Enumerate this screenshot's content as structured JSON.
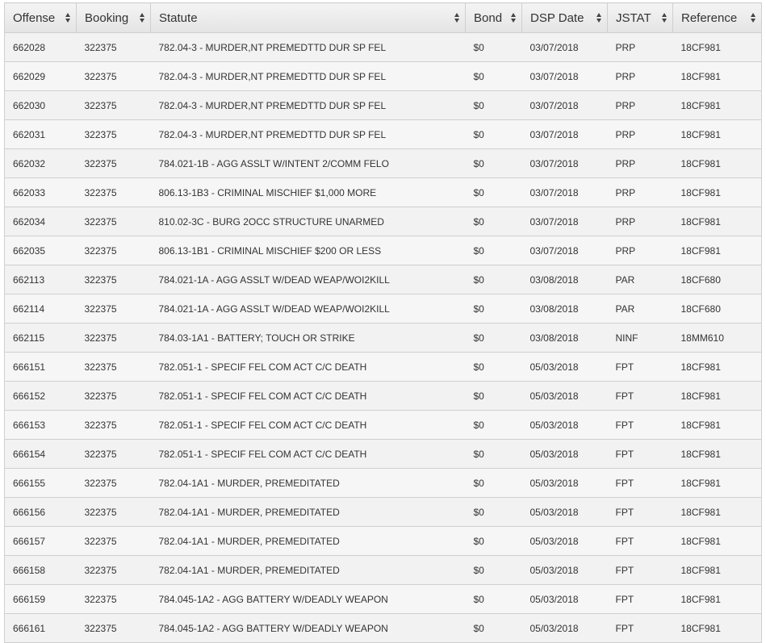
{
  "table": {
    "columns": [
      "Offense",
      "Booking",
      "Statute",
      "Bond",
      "DSP Date",
      "JSTAT",
      "Reference"
    ],
    "rows": [
      [
        "662028",
        "322375",
        "782.04-3 - MURDER,NT PREMEDTTD DUR SP FEL",
        "$0",
        "03/07/2018",
        "PRP",
        "18CF981"
      ],
      [
        "662029",
        "322375",
        "782.04-3 - MURDER,NT PREMEDTTD DUR SP FEL",
        "$0",
        "03/07/2018",
        "PRP",
        "18CF981"
      ],
      [
        "662030",
        "322375",
        "782.04-3 - MURDER,NT PREMEDTTD DUR SP FEL",
        "$0",
        "03/07/2018",
        "PRP",
        "18CF981"
      ],
      [
        "662031",
        "322375",
        "782.04-3 - MURDER,NT PREMEDTTD DUR SP FEL",
        "$0",
        "03/07/2018",
        "PRP",
        "18CF981"
      ],
      [
        "662032",
        "322375",
        "784.021-1B - AGG ASSLT W/INTENT 2/COMM FELO",
        "$0",
        "03/07/2018",
        "PRP",
        "18CF981"
      ],
      [
        "662033",
        "322375",
        "806.13-1B3 - CRIMINAL MISCHIEF $1,000 MORE",
        "$0",
        "03/07/2018",
        "PRP",
        "18CF981"
      ],
      [
        "662034",
        "322375",
        "810.02-3C - BURG 2OCC STRUCTURE UNARMED",
        "$0",
        "03/07/2018",
        "PRP",
        "18CF981"
      ],
      [
        "662035",
        "322375",
        "806.13-1B1 - CRIMINAL MISCHIEF $200 OR LESS",
        "$0",
        "03/07/2018",
        "PRP",
        "18CF981"
      ],
      [
        "662113",
        "322375",
        "784.021-1A - AGG ASSLT W/DEAD WEAP/WOI2KILL",
        "$0",
        "03/08/2018",
        "PAR",
        "18CF680"
      ],
      [
        "662114",
        "322375",
        "784.021-1A - AGG ASSLT W/DEAD WEAP/WOI2KILL",
        "$0",
        "03/08/2018",
        "PAR",
        "18CF680"
      ],
      [
        "662115",
        "322375",
        "784.03-1A1 - BATTERY; TOUCH OR STRIKE",
        "$0",
        "03/08/2018",
        "NINF",
        "18MM610"
      ],
      [
        "666151",
        "322375",
        "782.051-1 - SPECIF FEL COM ACT C/C DEATH",
        "$0",
        "05/03/2018",
        "FPT",
        "18CF981"
      ],
      [
        "666152",
        "322375",
        "782.051-1 - SPECIF FEL COM ACT C/C DEATH",
        "$0",
        "05/03/2018",
        "FPT",
        "18CF981"
      ],
      [
        "666153",
        "322375",
        "782.051-1 - SPECIF FEL COM ACT C/C DEATH",
        "$0",
        "05/03/2018",
        "FPT",
        "18CF981"
      ],
      [
        "666154",
        "322375",
        "782.051-1 - SPECIF FEL COM ACT C/C DEATH",
        "$0",
        "05/03/2018",
        "FPT",
        "18CF981"
      ],
      [
        "666155",
        "322375",
        "782.04-1A1 - MURDER, PREMEDITATED",
        "$0",
        "05/03/2018",
        "FPT",
        "18CF981"
      ],
      [
        "666156",
        "322375",
        "782.04-1A1 - MURDER, PREMEDITATED",
        "$0",
        "05/03/2018",
        "FPT",
        "18CF981"
      ],
      [
        "666157",
        "322375",
        "782.04-1A1 - MURDER, PREMEDITATED",
        "$0",
        "05/03/2018",
        "FPT",
        "18CF981"
      ],
      [
        "666158",
        "322375",
        "782.04-1A1 - MURDER, PREMEDITATED",
        "$0",
        "05/03/2018",
        "FPT",
        "18CF981"
      ],
      [
        "666159",
        "322375",
        "784.045-1A2 - AGG BATTERY W/DEADLY WEAPON",
        "$0",
        "05/03/2018",
        "FPT",
        "18CF981"
      ],
      [
        "666161",
        "322375",
        "784.045-1A2 - AGG BATTERY W/DEADLY WEAPON",
        "$0",
        "05/03/2018",
        "FPT",
        "18CF981"
      ]
    ]
  }
}
